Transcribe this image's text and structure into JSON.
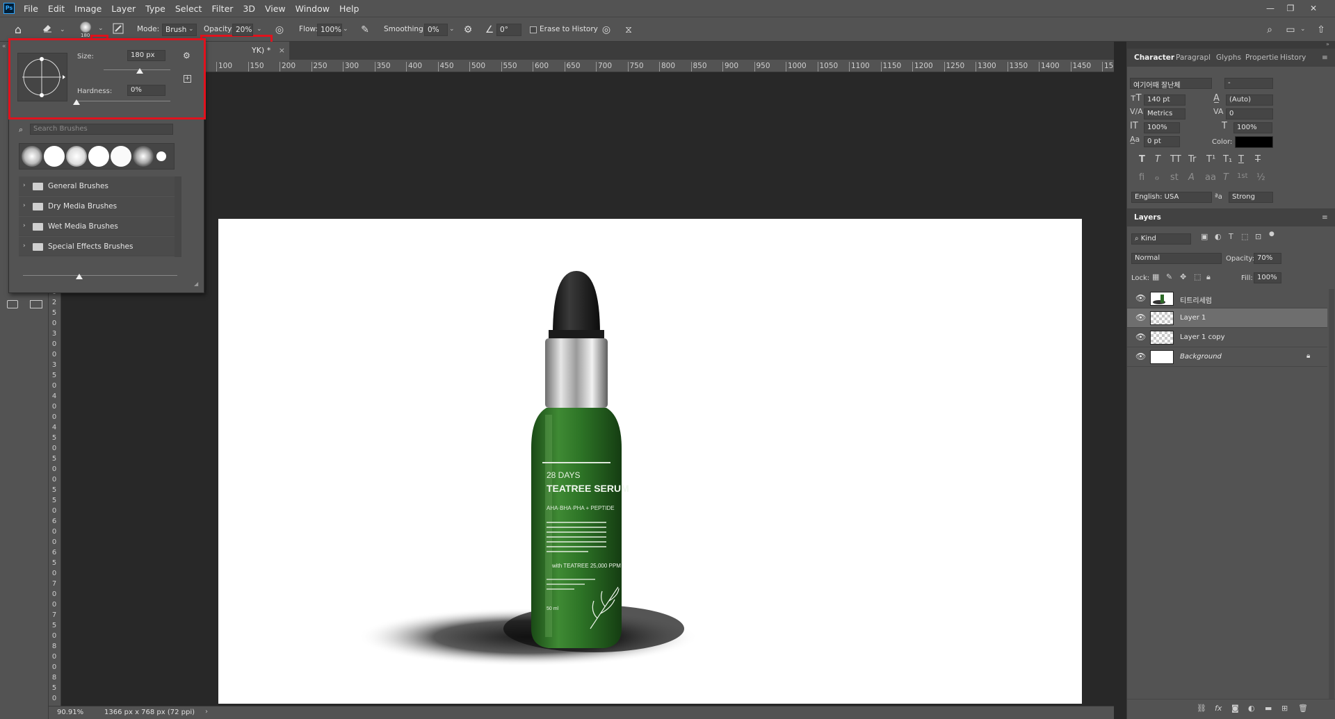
{
  "app": {
    "logo": "Ps"
  },
  "menu": [
    "File",
    "Edit",
    "Image",
    "Layer",
    "Type",
    "Select",
    "Filter",
    "3D",
    "View",
    "Window",
    "Help"
  ],
  "window_controls": [
    "minimize-icon",
    "restore-icon",
    "close-icon"
  ],
  "options_bar": {
    "brush_size_small": "180",
    "mode_label": "Mode:",
    "mode_value": "Brush",
    "opacity_label": "Opacity:",
    "opacity_value": "20%",
    "flow_label": "Flow:",
    "flow_value": "100%",
    "smoothing_label": "Smoothing:",
    "smoothing_value": "0%",
    "angle_value": "0°",
    "erase_to_history": "Erase to History"
  },
  "brush_popup": {
    "size_label": "Size:",
    "size_value": "180 px",
    "hardness_label": "Hardness:",
    "hardness_value": "0%",
    "search_placeholder": "Search Brushes",
    "folders": [
      "General Brushes",
      "Dry Media Brushes",
      "Wet Media Brushes",
      "Special Effects Brushes"
    ]
  },
  "document": {
    "tab_title": "YK) *",
    "zoom": "90.91%",
    "doc_info": "1366 px x 768 px (72 ppi)"
  },
  "ruler": {
    "h": [
      "100",
      "150",
      "200",
      "250",
      "300",
      "350",
      "400",
      "450",
      "500",
      "550",
      "600",
      "650",
      "700",
      "750",
      "800",
      "850",
      "900",
      "950",
      "1000",
      "1050",
      "1100",
      "1150",
      "1200",
      "1250",
      "1300",
      "1350",
      "1400",
      "1450",
      "15"
    ],
    "v": [
      "0",
      "2",
      "5",
      "0",
      "3",
      "0",
      "0",
      "3",
      "5",
      "0",
      "4",
      "0",
      "0",
      "4",
      "5",
      "0",
      "5",
      "0",
      "0",
      "5",
      "5",
      "0",
      "6",
      "0",
      "0",
      "6",
      "5",
      "0",
      "7",
      "0",
      "0",
      "7",
      "5",
      "0",
      "8",
      "0",
      "0",
      "8",
      "5",
      "0"
    ]
  },
  "product": {
    "line1": "28 DAYS",
    "line2": "TEATREE SERUM",
    "line3": "AHA·BHA·PHA + PEPTIDE",
    "line4": "with TEATREE 25,000 PPM",
    "volume": "50 ml"
  },
  "character_panel": {
    "tabs": [
      "Character",
      "Paragrapl",
      "Glyphs",
      "Propertie",
      "History"
    ],
    "font_family": "여기어때 잘난체",
    "font_style": "-",
    "font_size": "140 pt",
    "leading": "(Auto)",
    "kerning": "Metrics",
    "tracking": "0",
    "vscale": "100%",
    "hscale": "100%",
    "baseline": "0 pt",
    "color_label": "Color:",
    "color": "#000000",
    "language": "English: USA",
    "antialias_symbol": "ªa",
    "antialias": "Strong",
    "style_buttons": [
      "T",
      "T",
      "TT",
      "Tr",
      "T¹",
      "T₁",
      "T",
      "T"
    ],
    "ot_buttons": [
      "fi",
      "ℴ",
      "st",
      "A",
      "aa",
      "T",
      "1st",
      "½"
    ]
  },
  "layers_panel": {
    "title": "Layers",
    "filter_kind": "Kind",
    "blend_mode": "Normal",
    "opacity_label": "Opacity:",
    "opacity_value": "70%",
    "lock_label": "Lock:",
    "fill_label": "Fill:",
    "fill_value": "100%",
    "layers": [
      {
        "name": "티트리세럼",
        "type": "image"
      },
      {
        "name": "Layer 1",
        "type": "transparent",
        "selected": true
      },
      {
        "name": "Layer 1 copy",
        "type": "transparent"
      },
      {
        "name": "Background",
        "type": "white",
        "locked": true
      }
    ]
  },
  "colors": {
    "highlight": "#e0121d",
    "ui_bg": "#535353",
    "canvas_bg": "#282828",
    "bottle_green": "#2f7a2a"
  }
}
